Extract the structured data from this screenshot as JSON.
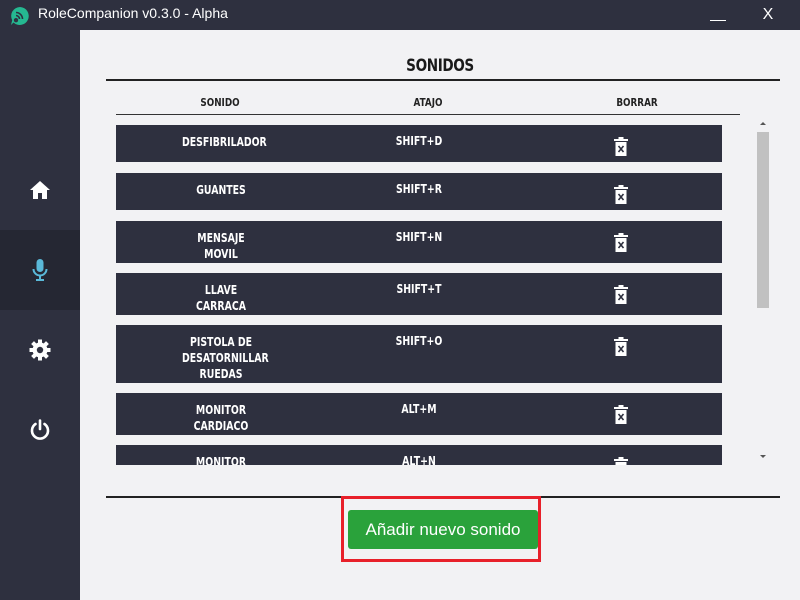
{
  "window": {
    "title": "RoleCompanion v0.3.0 - Alpha",
    "minimize_glyph": "",
    "close_glyph": "X",
    "logo_icon": "chat-bubble-wifi-icon",
    "accent": "#25b891"
  },
  "sidebar": {
    "items": [
      {
        "id": "home",
        "icon": "home-icon",
        "active": false
      },
      {
        "id": "sounds",
        "icon": "microphone-icon",
        "active": true
      },
      {
        "id": "settings",
        "icon": "gear-icon",
        "active": false
      },
      {
        "id": "power",
        "icon": "power-icon",
        "active": false
      }
    ]
  },
  "main": {
    "title": "SONIDOS",
    "columns": {
      "sound": "SONIDO",
      "shortcut": "ATAJO",
      "delete": "BORRAR"
    },
    "rows": [
      {
        "name": "DESFIBRILADOR",
        "shortcut": "SHIFT+D"
      },
      {
        "name": "GUANTES",
        "shortcut": "SHIFT+R"
      },
      {
        "name": "MENSAJE\nMOVIL",
        "shortcut": "SHIFT+N"
      },
      {
        "name": "LLAVE\nCARRACA",
        "shortcut": "SHIFT+T"
      },
      {
        "name": "PISTOLA DE\nDESATORNILLAR\nRUEDAS",
        "shortcut": "SHIFT+O"
      },
      {
        "name": "MONITOR\nCARDIACO",
        "shortcut": "ALT+M"
      },
      {
        "name": "MONITOR",
        "shortcut": "ALT+N"
      }
    ],
    "delete_icon": "trash-icon",
    "add_button": "Añadir nuevo sonido"
  },
  "colors": {
    "sidebar_bg": "#2e303f",
    "row_bg": "#2e303f",
    "button_green": "#2aa23b",
    "highlight_red": "#e8202a"
  }
}
